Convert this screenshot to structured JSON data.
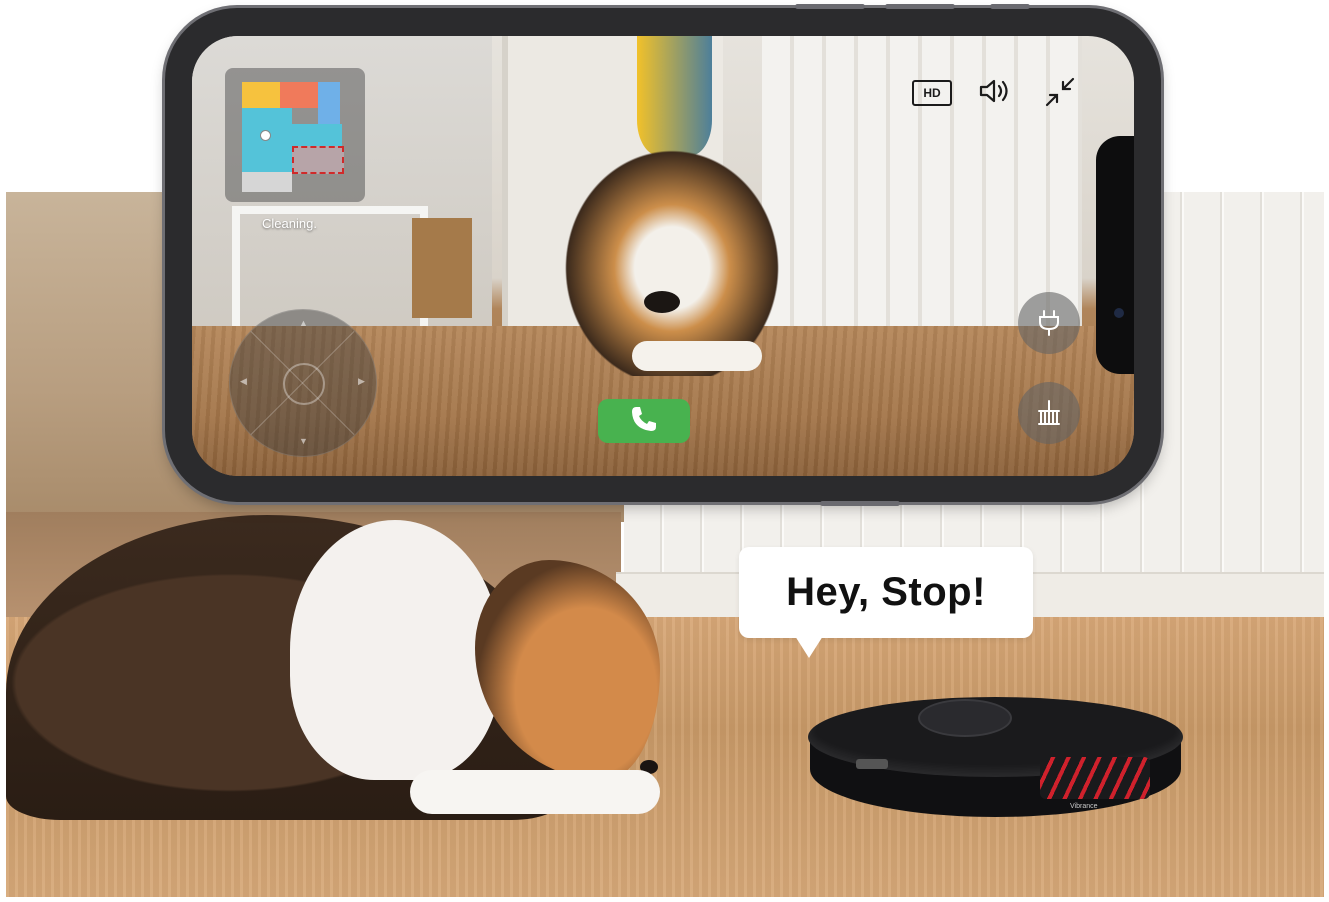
{
  "speech_bubble": {
    "text": "Hey, Stop!"
  },
  "phone_app": {
    "status_text": "Cleaning.",
    "quality_badge": "HD",
    "icons": {
      "volume": "volume-icon",
      "exit_fullscreen": "exit-fullscreen-icon",
      "call": "phone-call-icon",
      "charge": "charge-plug-icon",
      "mop": "mop-brush-icon",
      "joystick": "direction-joystick"
    },
    "map_colors": [
      "#f6c23e",
      "#f07a5b",
      "#6fb0e8",
      "#54c3d9",
      "#b7a4a8",
      "#d6d6d6"
    ]
  },
  "robot": {
    "brand_text": "Vibrance"
  },
  "colors": {
    "call_green": "#48b24f",
    "robot_red": "#d0212c"
  }
}
